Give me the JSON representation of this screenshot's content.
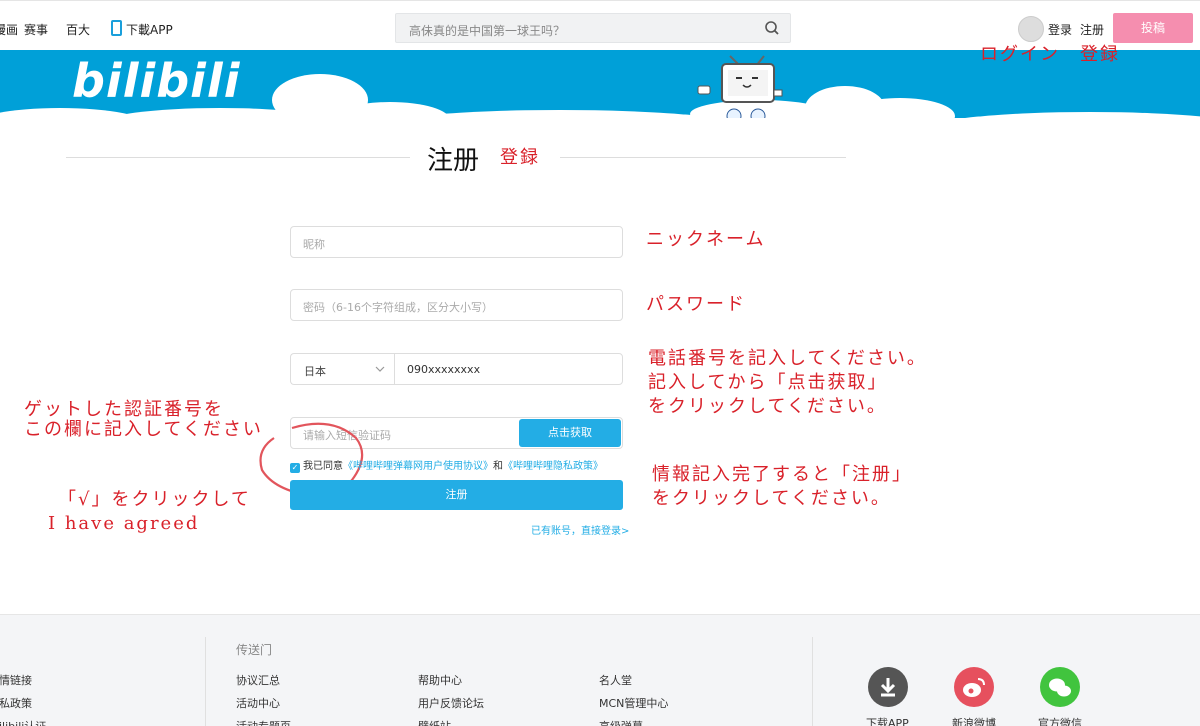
{
  "topnav": {
    "items": [
      "漫画",
      "赛事",
      "百大"
    ],
    "download_app": "下載APP",
    "search_placeholder": "高佅真的是中国第一球王吗？",
    "login": "登录",
    "register": "注册",
    "upload": "投稿"
  },
  "banner": {
    "logo": "bilibili"
  },
  "annotations": {
    "top_right": "ログイン　登録",
    "title_jp": "登録",
    "nickname": "ニックネーム",
    "password": "パスワード",
    "phone_1": "電話番号を記入してください。",
    "phone_2": "記入してから「点击获取」",
    "phone_3": "をクリックしてください。",
    "code_1": "ゲットした認証番号を",
    "code_2": "この欄に記入してください",
    "agree_1": "「√」をクリックして",
    "agree_2": "I have agreed",
    "submit_1": "情報記入完了すると「注册」",
    "submit_2": "をクリックしてください。"
  },
  "form": {
    "title": "注册",
    "nickname_placeholder": "昵称",
    "password_placeholder": "密码（6-16个字符组成，区分大小写）",
    "country": "日本",
    "phone": "090xxxxxxxx",
    "code_placeholder": "请输入短信验证码",
    "get_code": "点击获取",
    "agree_prefix": "我已同意",
    "agree_link_1": "《哔哩哔哩弹幕网用户使用协议》",
    "agree_and": "和",
    "agree_link_2": "《哔哩哔哩隐私政策》",
    "submit": "注册",
    "login_link": "已有账号，直接登录>"
  },
  "footer": {
    "col0": [
      "友情链接",
      "隐私政策",
      "bilibili认证"
    ],
    "col1_title": "传送门",
    "col1": [
      "协议汇总",
      "活动中心",
      "活动专题页"
    ],
    "col2": [
      "帮助中心",
      "用户反馈论坛",
      "壁纸站"
    ],
    "col3": [
      "名人堂",
      "MCN管理中心",
      "高级弹幕"
    ],
    "social": [
      "下载APP",
      "新浪微博",
      "官方微信"
    ]
  },
  "colors": {
    "brand_blue": "#00a0d8",
    "button_blue": "#23ade5",
    "upload_pink": "#f58eaf",
    "annotation_red": "#d9212a"
  }
}
